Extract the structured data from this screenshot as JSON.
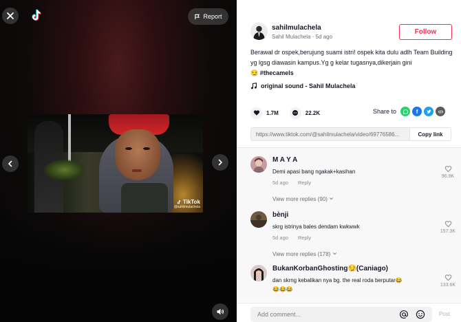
{
  "video": {
    "report_label": "Report",
    "watermark_brand": "TikTok",
    "watermark_user": "@sahilmulachela"
  },
  "author": {
    "username": "sahilmulachela",
    "display_name": "Sahil Mulachela",
    "posted": "5d ago",
    "follow_label": "Follow"
  },
  "caption": {
    "text": "Berawal dr ospek,berujung suami istri! ospek kita dulu adlh Team Building yg lgsg diawasin kampus.Yg g kelar tugasnya,dikerjain gini",
    "emoji": "😏",
    "hashtag": "#thecamels"
  },
  "music": {
    "title": "original sound - Sahil Mulachela"
  },
  "stats": {
    "likes": "1.7M",
    "comments": "22.2K"
  },
  "share": {
    "label": "Share to"
  },
  "link": {
    "url": "https://www.tiktok.com/@sahilmulachela/video/69776586...",
    "copy_label": "Copy link"
  },
  "comments": [
    {
      "name": "M A Y A",
      "text": "Demi apasi bang ngakak+kasihan",
      "time": "5d ago",
      "reply": "Reply",
      "likes": "96.9K",
      "more": "View more replies (90)"
    },
    {
      "name": "bènji",
      "text": "skrg istrinya bales dendam kwkwwk",
      "time": "5d ago",
      "reply": "Reply",
      "likes": "157.3K",
      "more": "View more replies (178)"
    },
    {
      "name": "BukanKorbanGhosting😏(Caniago)",
      "text": "dan skrng kebalikan nya bg. the real roda berputar😂",
      "text2": "😂😂😂",
      "likes": "133.6K"
    }
  ],
  "comment_bar": {
    "placeholder": "Add comment...",
    "post_label": "Post"
  },
  "colors": {
    "accent": "#fe2c55",
    "whatsapp": "#25d366",
    "facebook": "#1877f2",
    "twitter": "#1da1f2",
    "embed": "#5c5c5c"
  }
}
